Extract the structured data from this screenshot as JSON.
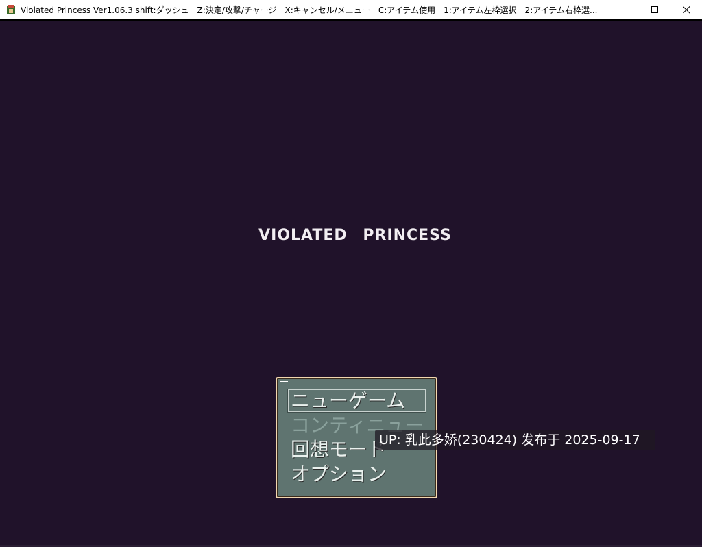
{
  "window": {
    "title": "Violated Princess Ver1.06.3 shift:ダッシュ　Z:決定/攻撃/チャージ　X:キャンセル/メニュー　C:アイテム使用　1:アイテム左枠選択　2:アイテム右枠選...",
    "controls": {
      "minimize": "─",
      "maximize": "☐",
      "close": "✕"
    }
  },
  "game": {
    "title": "VIOLATED PRINCESS",
    "menu": {
      "items": [
        {
          "label": "ニューゲーム",
          "enabled": true,
          "selected": true
        },
        {
          "label": "コンティニュー",
          "enabled": false,
          "selected": false
        },
        {
          "label": "回想モード",
          "enabled": true,
          "selected": false
        },
        {
          "label": "オプション",
          "enabled": true,
          "selected": false
        }
      ]
    }
  },
  "overlay": {
    "uploader_text": "UP: 乳此多娇(230424) 发布于 2025-09-17"
  },
  "colors": {
    "background": "#20122a",
    "menu_bg": "#5f7470",
    "menu_border": "#f2d7b0",
    "text_light": "#eaf1ee",
    "text_disabled": "#8aa19c"
  }
}
